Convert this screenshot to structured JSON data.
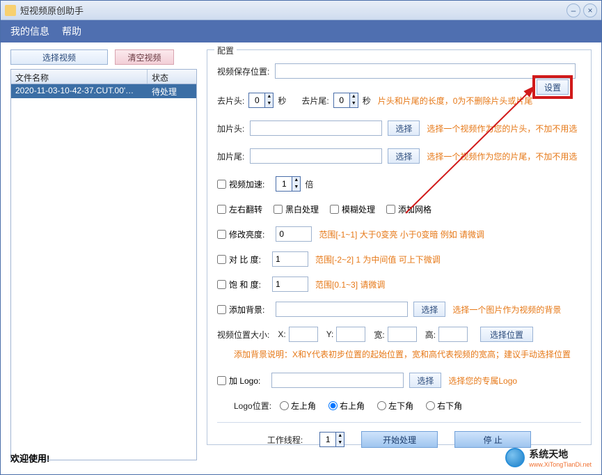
{
  "app": {
    "title": "短视频原创助手"
  },
  "menu": {
    "my_info": "我的信息",
    "help": "帮助"
  },
  "left": {
    "select_video": "选择视频",
    "clear_video": "清空视频",
    "col_filename": "文件名称",
    "col_status": "状态",
    "rows": [
      {
        "name": "2020-11-03-10-42-37.CUT.00'…",
        "status": "待处理"
      }
    ]
  },
  "config": {
    "legend": "配置",
    "save_path_label": "视频保存位置:",
    "save_path_value": "",
    "set_btn": "设置",
    "trim_head_label": "去片头:",
    "trim_head_value": "0",
    "sec1": "秒",
    "trim_tail_label": "去片尾:",
    "trim_tail_value": "0",
    "sec2": "秒",
    "trim_hint": "片头和片尾的长度，0为不删除片头或片尾",
    "add_head_label": "加片头:",
    "add_head_value": "",
    "choose": "选择",
    "add_head_hint": "选择一个视频作为您的片头，不加不用选",
    "add_tail_label": "加片尾:",
    "add_tail_value": "",
    "add_tail_hint": "选择一个视频作为您的片尾，不加不用选",
    "speed_chk": "视频加速:",
    "speed_value": "1",
    "speed_unit": "倍",
    "flip_chk": "左右翻转",
    "bw_chk": "黑白处理",
    "blur_chk": "模糊处理",
    "grid_chk": "添加网格",
    "bright_chk": "修改亮度:",
    "bright_value": "0",
    "bright_hint": "范围[-1~1]    大于0变亮  小于0变暗    例如  请微调",
    "contrast_chk": "对 比  度:",
    "contrast_value": "1",
    "contrast_hint": "范围[-2~2]   1 为中间值  可上下微调",
    "saturate_chk": "饱 和  度:",
    "saturate_value": "1",
    "saturate_hint": "范围[0.1~3]   请微调",
    "bg_chk": "添加背景:",
    "bg_value": "",
    "bg_hint": "选择一个图片作为视频的背景",
    "pos_label": "视频位置大小:",
    "x_label": "X:",
    "y_label": "Y:",
    "w_label": "宽:",
    "h_label": "高:",
    "pos_btn": "选择位置",
    "bg_note": "添加背景说明：X和Y代表初步位置的起始位置，宽和高代表视频的宽高；建议手动选择位置",
    "logo_chk": "加 Logo:",
    "logo_value": "",
    "logo_hint": "选择您的专属Logo",
    "logo_pos_label": "Logo位置:",
    "radios": {
      "tl": "左上角",
      "tr": "右上角",
      "bl": "左下角",
      "br": "右下角"
    },
    "threads_label": "工作线程:",
    "threads_value": "1",
    "start_btn": "开始处理",
    "stop_btn": "停  止"
  },
  "footer": {
    "welcome": "欢迎使用!",
    "brand_cn": "系统天地",
    "brand_en": "www.XiTongTianDi.net"
  }
}
